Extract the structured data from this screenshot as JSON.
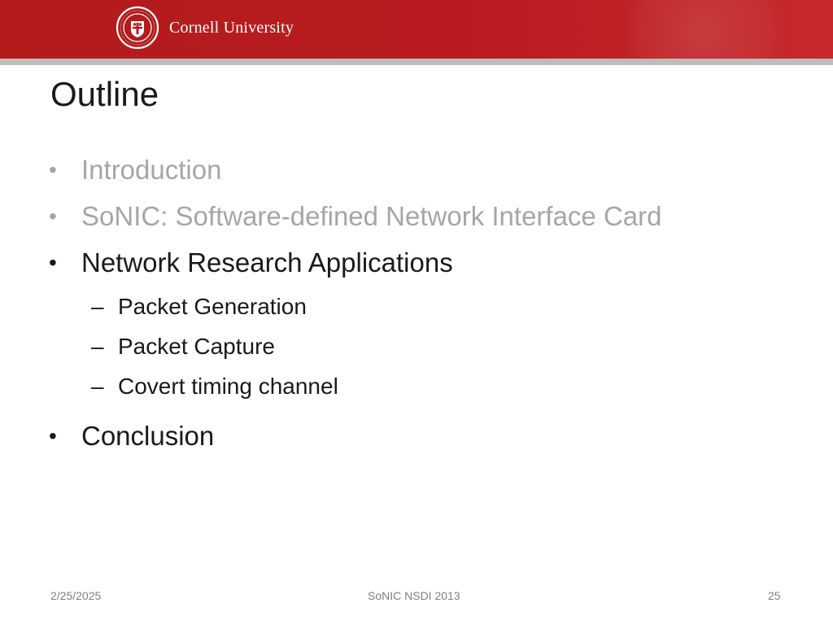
{
  "header": {
    "wordmark": "Cornell University",
    "seal_icon": "cornell-seal-icon",
    "colors": {
      "banner": "#b31b1b",
      "strip": "#bdbdbd"
    }
  },
  "slide": {
    "title": "Outline",
    "bullets": [
      {
        "text": "Introduction",
        "state": "dimmed"
      },
      {
        "text": "SoNIC: Software-defined Network Interface Card",
        "state": "dimmed"
      },
      {
        "text": "Network Research Applications",
        "state": "active",
        "sub": [
          "Packet Generation",
          "Packet Capture",
          "Covert timing channel"
        ]
      },
      {
        "text": "Conclusion",
        "state": "normal"
      }
    ],
    "bullet_symbol": "•",
    "sub_symbol": "–",
    "colors": {
      "dimmed_text": "#a6a6a6",
      "active_text": "#1a1a1a"
    }
  },
  "footer": {
    "date": "2/25/2025",
    "center": "SoNIC NSDI 2013",
    "page": "25"
  }
}
